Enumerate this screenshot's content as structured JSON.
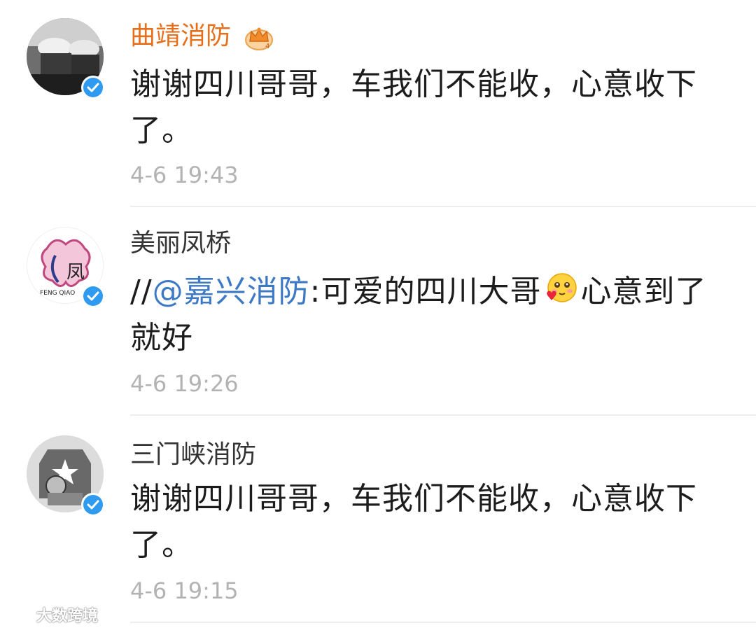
{
  "comments": [
    {
      "username": "曲靖消防",
      "is_vip": true,
      "content": "谢谢四川哥哥，车我们不能收，心意收下了。",
      "timestamp": "4-6 19:43"
    },
    {
      "username": "美丽凤桥",
      "is_vip": false,
      "avatar_text": "FENG QIAO",
      "content_prefix": "//",
      "mention": "@嘉兴消防",
      "content_mid": ":可爱的四川大哥",
      "content_suffix": "心意到了就好",
      "timestamp": "4-6 19:26"
    },
    {
      "username": "三门峡消防",
      "is_vip": false,
      "content": "谢谢四川哥哥，车我们不能收，心意收下了。",
      "timestamp": "4-6 19:15"
    }
  ],
  "colors": {
    "vip_name": "#e66f1b",
    "mention": "#3d79c5",
    "verified": "#2e9bf0"
  },
  "watermark": "大数跨境"
}
